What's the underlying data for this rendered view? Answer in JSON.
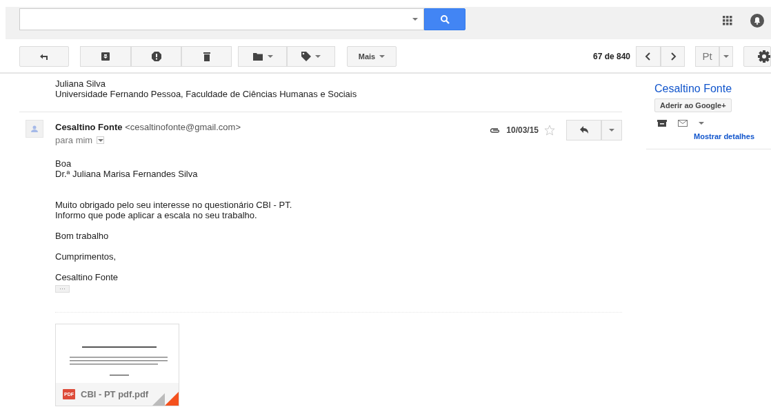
{
  "toolbar": {
    "more_label": "Mais",
    "counter": "67 de 840",
    "language": "Pt"
  },
  "thread": {
    "signature": [
      "Juliana Silva",
      "Universidade Fernando Pessoa, Faculdade de Ciências Humanas e Sociais"
    ],
    "message": {
      "sender_name": "Cesaltino Fonte",
      "sender_email": "<cesaltinofonte@gmail.com>",
      "recipient": "para mim",
      "date": "10/03/15",
      "starred": false,
      "has_attachment": true,
      "body": [
        [
          "Boa",
          "Dr.ª Juliana Marisa Fernandes Silva"
        ],
        [
          "Muito obrigado pelo seu interesse no questionário CBI - PT.",
          "Informo que pode aplicar a escala no seu trabalho."
        ],
        [
          "Bom trabalho"
        ],
        [
          "Cumprimentos,"
        ],
        [
          "Cesaltino Fonte"
        ]
      ],
      "trimmed_toggle": "···",
      "attachment": {
        "badge": "PDF",
        "filename": "CBI - PT pdf.pdf"
      }
    }
  },
  "contact_panel": {
    "name": "Cesaltino Fonte",
    "join_button": "Aderir ao Google+",
    "details_link": "Mostrar detalhes"
  }
}
